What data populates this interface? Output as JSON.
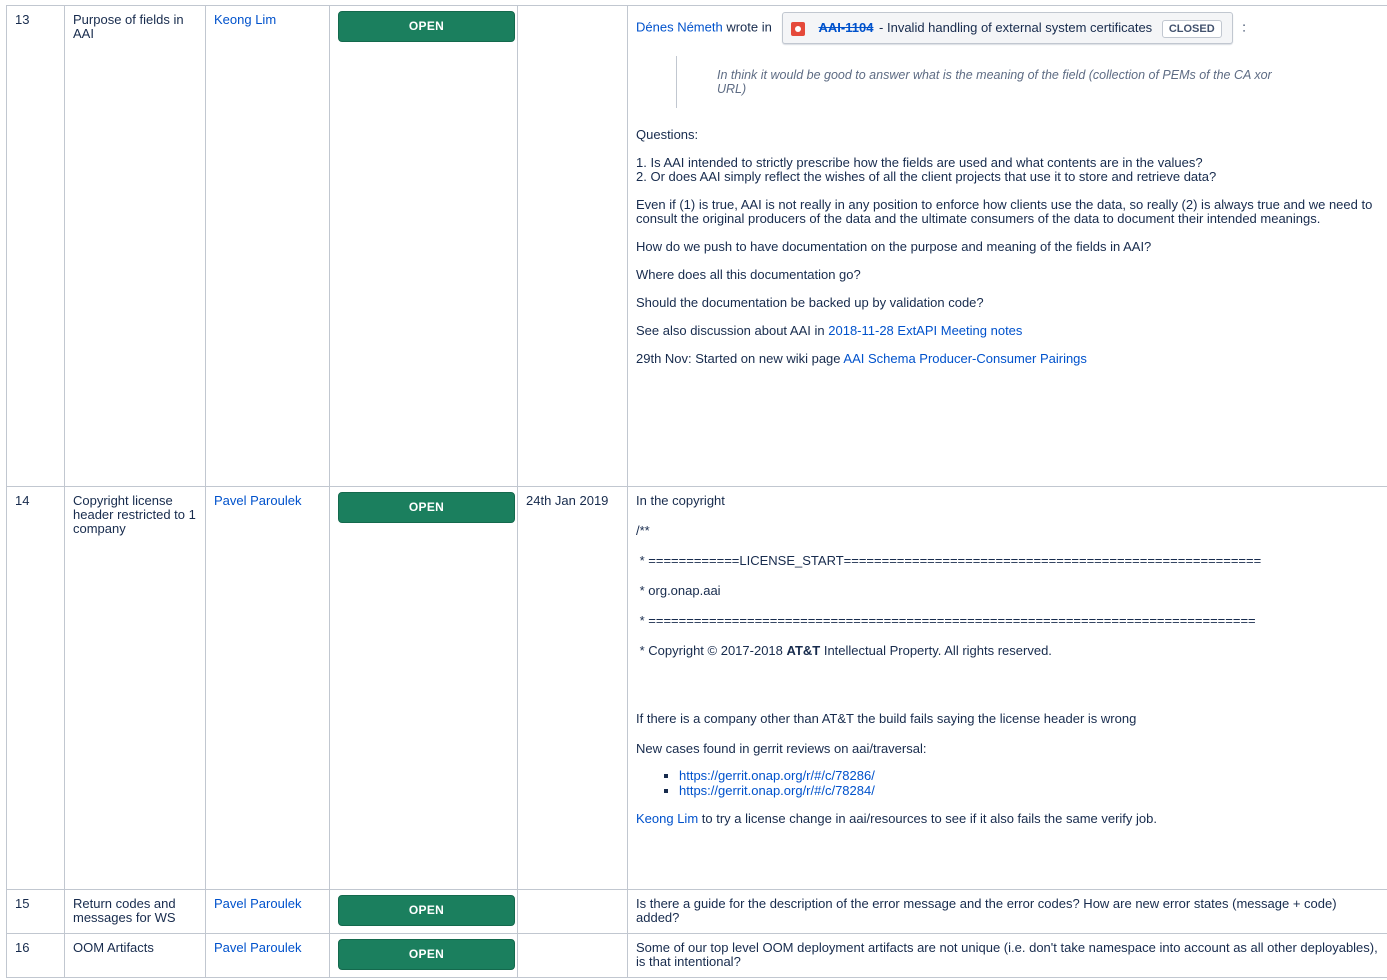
{
  "rows": [
    {
      "num": "13",
      "topic": "Purpose of fields in AAI",
      "owner": "Keong Lim",
      "status": "OPEN",
      "date": "",
      "notes": {
        "author": "Dénes Németh",
        "wrote_in": "wrote in",
        "jira_key": "AAI-1104",
        "jira_title": "- Invalid handling of external system certificates",
        "jira_status": "CLOSED",
        "colon": ":",
        "quote": "In think it would be good to answer what is the meaning of the field (collection of PEMs of the CA xor URL)",
        "questions": "Questions:",
        "q1": "1. Is AAI intended to strictly prescribe how the fields are used and what contents are in the values?",
        "q2": "2. Or does AAI simply reflect the wishes of all the client projects that use it to store and retrieve data?",
        "p_even": "Even if (1) is true, AAI is not really in any position to enforce how clients use the data, so really (2) is always true and we need to consult the original producers of the data and the ultimate consumers of the data to document their intended meanings.",
        "p_push": "How do we push to have documentation on the purpose and meaning of the fields in AAI?",
        "p_where": "Where does all this documentation go?",
        "p_backed": "Should the documentation be backed up by validation code?",
        "see_also": "See also discussion about AAI in",
        "see_also_link": "2018-11-28 ExtAPI Meeting notes",
        "nov_prefix": "29th Nov: Started on new wiki page",
        "nov_link": "AAI Schema Producer-Consumer Pairings"
      }
    },
    {
      "num": "14",
      "topic": "Copyright license header restricted to 1 company",
      "owner": "Pavel Paroulek",
      "status": "OPEN",
      "date": "24th Jan 2019",
      "notes": {
        "p1": "In the copyright",
        "p2": "/**",
        "p3": " * ============LICENSE_START=======================================================",
        "p4": " * org.onap.aai",
        "p5": " * ================================================================================",
        "p6_prefix": " * Copyright © 2017-2018 ",
        "p6_bold": "AT&T",
        "p6_suffix": " Intellectual Property. All rights reserved.",
        "p7": "If there is a company other than AT&T the build fails saying the license header is wrong",
        "p8": "New cases found in gerrit reviews on aai/traversal:",
        "links": [
          "https://gerrit.onap.org/r/#/c/78286/",
          "https://gerrit.onap.org/r/#/c/78284/"
        ],
        "p9_link": "Keong Lim",
        "p9_suffix": " to try a license change in aai/resources to see if it also fails the same verify job."
      }
    },
    {
      "num": "15",
      "topic": "Return codes and messages for WS",
      "owner": "Pavel Paroulek",
      "status": "OPEN",
      "date": "",
      "notes": "Is there a guide for the description of the error message and the error codes? How are new error states (message + code) added?"
    },
    {
      "num": "16",
      "topic": "OOM Artifacts",
      "owner": "Pavel Paroulek",
      "status": "OPEN",
      "date": "",
      "notes": "Some of our top level OOM deployment artifacts are not unique (i.e. don't take namespace into account as all other deployables), is that intentional?"
    }
  ],
  "colors": {
    "status_green": "#1b7f5e",
    "link": "#0052cc",
    "jira_icon": "#e5493a",
    "border": "#c1c7d0"
  }
}
